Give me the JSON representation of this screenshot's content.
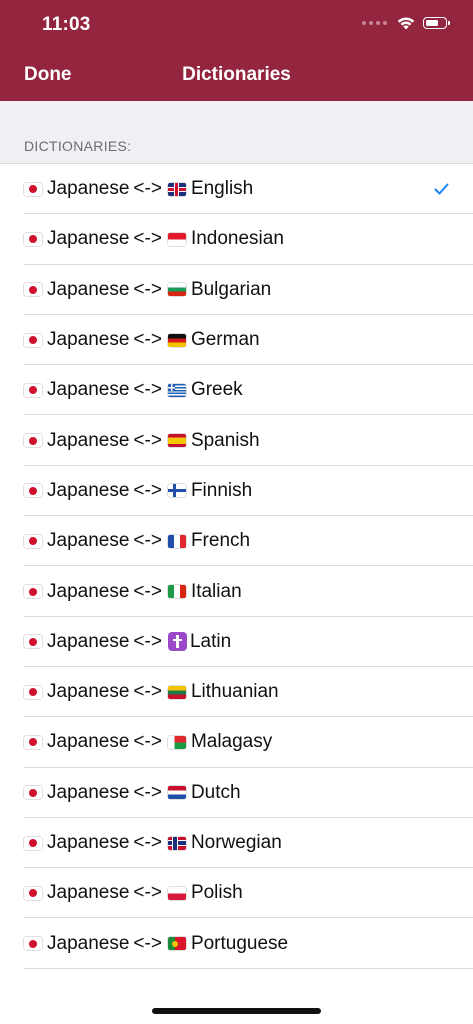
{
  "status_bar": {
    "time": "11:03"
  },
  "navbar": {
    "done_label": "Done",
    "title": "Dictionaries"
  },
  "section": {
    "header": "DICTIONARIES:"
  },
  "accent_color": "#93253f",
  "check_color": "#1a82f7",
  "dictionaries": [
    {
      "source": "Japanese",
      "separator": "<->",
      "target": "English",
      "source_flag": "flag-japan-icon",
      "target_flag": "flag-uk-icon",
      "selected": true
    },
    {
      "source": "Japanese",
      "separator": "<->",
      "target": "Indonesian",
      "source_flag": "flag-japan-icon",
      "target_flag": "flag-indonesia-icon",
      "selected": false
    },
    {
      "source": "Japanese",
      "separator": "<->",
      "target": "Bulgarian",
      "source_flag": "flag-japan-icon",
      "target_flag": "flag-bulgaria-icon",
      "selected": false
    },
    {
      "source": "Japanese",
      "separator": "<->",
      "target": "German",
      "source_flag": "flag-japan-icon",
      "target_flag": "flag-germany-icon",
      "selected": false
    },
    {
      "source": "Japanese",
      "separator": "<->",
      "target": "Greek",
      "source_flag": "flag-japan-icon",
      "target_flag": "flag-greece-icon",
      "selected": false
    },
    {
      "source": "Japanese",
      "separator": "<->",
      "target": "Spanish",
      "source_flag": "flag-japan-icon",
      "target_flag": "flag-spain-icon",
      "selected": false
    },
    {
      "source": "Japanese",
      "separator": "<->",
      "target": "Finnish",
      "source_flag": "flag-japan-icon",
      "target_flag": "flag-finland-icon",
      "selected": false
    },
    {
      "source": "Japanese",
      "separator": "<->",
      "target": "French",
      "source_flag": "flag-japan-icon",
      "target_flag": "flag-france-icon",
      "selected": false
    },
    {
      "source": "Japanese",
      "separator": "<->",
      "target": "Italian",
      "source_flag": "flag-japan-icon",
      "target_flag": "flag-italy-icon",
      "selected": false
    },
    {
      "source": "Japanese",
      "separator": "<->",
      "target": "Latin",
      "source_flag": "flag-japan-icon",
      "target_flag": "latin-cross-icon",
      "selected": false
    },
    {
      "source": "Japanese",
      "separator": "<->",
      "target": "Lithuanian",
      "source_flag": "flag-japan-icon",
      "target_flag": "flag-lithuania-icon",
      "selected": false
    },
    {
      "source": "Japanese",
      "separator": "<->",
      "target": "Malagasy",
      "source_flag": "flag-japan-icon",
      "target_flag": "flag-madagascar-icon",
      "selected": false
    },
    {
      "source": "Japanese",
      "separator": "<->",
      "target": "Dutch",
      "source_flag": "flag-japan-icon",
      "target_flag": "flag-netherlands-icon",
      "selected": false
    },
    {
      "source": "Japanese",
      "separator": "<->",
      "target": "Norwegian",
      "source_flag": "flag-japan-icon",
      "target_flag": "flag-norway-icon",
      "selected": false
    },
    {
      "source": "Japanese",
      "separator": "<->",
      "target": "Polish",
      "source_flag": "flag-japan-icon",
      "target_flag": "flag-poland-icon",
      "selected": false
    },
    {
      "source": "Japanese",
      "separator": "<->",
      "target": "Portuguese",
      "source_flag": "flag-japan-icon",
      "target_flag": "flag-portugal-icon",
      "selected": false
    }
  ]
}
